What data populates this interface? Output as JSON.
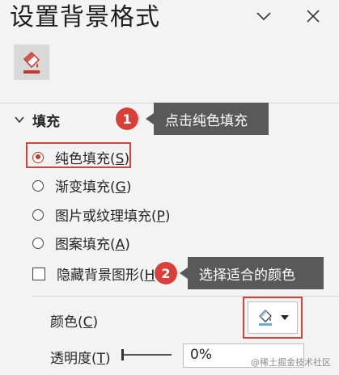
{
  "pane": {
    "title": "设置背景格式",
    "dropdown_icon": "chevron-down-icon",
    "close_icon": "close-icon"
  },
  "tabs": [
    {
      "icon": "paint-bucket-icon",
      "active": true
    }
  ],
  "fill_section": {
    "header": "填充",
    "options": [
      {
        "label": "纯色填充(",
        "key": "S",
        "suffix": ")",
        "type": "radio",
        "checked": true
      },
      {
        "label": "渐变填充(",
        "key": "G",
        "suffix": ")",
        "type": "radio",
        "checked": false
      },
      {
        "label": "图片或纹理填充(",
        "key": "P",
        "suffix": ")",
        "type": "radio",
        "checked": false
      },
      {
        "label": "图案填充(",
        "key": "A",
        "suffix": ")",
        "type": "radio",
        "checked": false
      }
    ],
    "hide_background_graphics": {
      "label": "隐藏背景图形(",
      "key": "H",
      "checked": false
    }
  },
  "properties": {
    "color_label": "颜色(",
    "color_key": "C",
    "color_suffix": ")",
    "transparency_label": "透明度(",
    "transparency_key": "T",
    "transparency_suffix": ")",
    "transparency_value": "0%"
  },
  "annotations": {
    "step1_number": "1",
    "step1_text": "点击纯色填充",
    "step2_number": "2",
    "step2_text": "选择适合的颜色"
  },
  "watermark": "@稀土掘金技术社区",
  "colors": {
    "accent_red": "#d9403a",
    "callout_bg": "#595959",
    "pane_bg": "#f3f3f3"
  }
}
